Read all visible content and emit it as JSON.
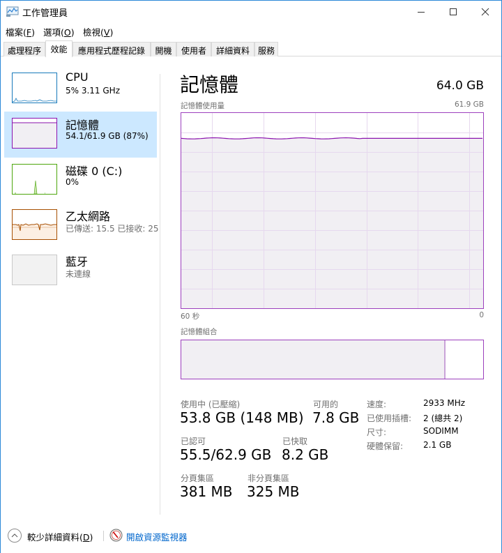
{
  "window": {
    "title": "工作管理員",
    "app_icon": "task-manager-icon",
    "controls": {
      "minimize": "minimize-icon",
      "maximize": "maximize-icon",
      "close": "close-icon"
    }
  },
  "menu": [
    {
      "label": "檔案(",
      "key": "F",
      "tail": ")"
    },
    {
      "label": "選項(",
      "key": "O",
      "tail": ")"
    },
    {
      "label": "檢視(",
      "key": "V",
      "tail": ")"
    }
  ],
  "tabs": [
    {
      "label": "處理程序",
      "active": false
    },
    {
      "label": "效能",
      "active": true
    },
    {
      "label": "應用程式歷程記錄",
      "active": false
    },
    {
      "label": "開機",
      "active": false
    },
    {
      "label": "使用者",
      "active": false
    },
    {
      "label": "詳細資料",
      "active": false
    },
    {
      "label": "服務",
      "active": false
    }
  ],
  "sidebar": {
    "items": [
      {
        "name": "CPU",
        "sub": "5% 3.11 GHz",
        "color": "#1779ba",
        "selected": false
      },
      {
        "name": "記憶體",
        "sub": "54.1/61.9 GB (87%)",
        "color": "#8b12ae",
        "selected": true,
        "usage_fraction": 0.87
      },
      {
        "name": "磁碟 0 (C:)",
        "sub": "0%",
        "color": "#4da60c",
        "selected": false
      },
      {
        "name": "乙太網路",
        "sub": "已傳送: 15.5 已接收: 25",
        "color": "#a74f01",
        "selected": false
      },
      {
        "name": "藍牙",
        "sub": "未連線",
        "color": "#c8c8c8",
        "selected": false
      }
    ]
  },
  "main": {
    "title": "記憶體",
    "total": "64.0 GB",
    "usage_chart": {
      "label": "記憶體使用量",
      "max_label": "61.9 GB",
      "x_left": "60 秒",
      "x_right": "0",
      "color": "#8b12ae",
      "usage_fraction": 0.87
    },
    "composition": {
      "label": "記憶體組合",
      "in_use_fraction": 0.87,
      "modified_fraction": 0.005
    },
    "stats": {
      "in_use_label": "使用中 (已壓縮)",
      "in_use_value": "53.8 GB (148 MB)",
      "available_label": "可用的",
      "available_value": "7.8 GB",
      "committed_label": "已認可",
      "committed_value": "55.5/62.9 GB",
      "cached_label": "已快取",
      "cached_value": "8.2 GB",
      "paged_label": "分頁集區",
      "paged_value": "381 MB",
      "nonpaged_label": "非分頁集區",
      "nonpaged_value": "325 MB"
    },
    "details": [
      {
        "label": "速度:",
        "value": "2933 MHz"
      },
      {
        "label": "已使用插槽:",
        "value": "2 (總共 2)"
      },
      {
        "label": "尺寸:",
        "value": "SODIMM"
      },
      {
        "label": "硬體保留:",
        "value": "2.1 GB"
      }
    ]
  },
  "footer": {
    "fewer_details_label": "較少詳細資料(",
    "fewer_details_key": "D",
    "fewer_details_tail": ")",
    "resource_monitor_label": "開啟資源監視器"
  }
}
